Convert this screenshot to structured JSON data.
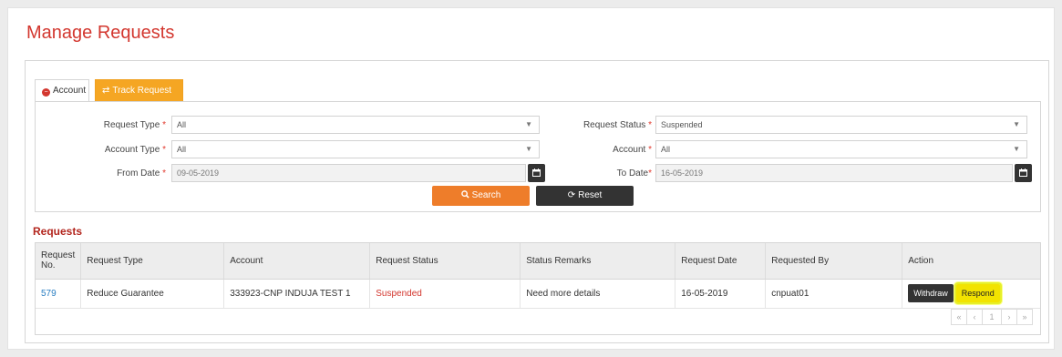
{
  "page": {
    "title": "Manage Requests"
  },
  "tabs": [
    {
      "label": "Account",
      "icon": "minus-circle-icon"
    },
    {
      "label": "Track Request",
      "icon": "exchange-icon"
    }
  ],
  "form": {
    "request_type": {
      "label": "Request Type",
      "value": "All"
    },
    "request_status": {
      "label": "Request Status",
      "value": "Suspended"
    },
    "account_type": {
      "label": "Account Type",
      "value": "All"
    },
    "account": {
      "label": "Account",
      "value": "All"
    },
    "from_date": {
      "label": "From Date",
      "value": "09-05-2019"
    },
    "to_date": {
      "label": "To Date",
      "value": "16-05-2019"
    },
    "required_mark": "*",
    "search_label": "Search",
    "reset_label": "Reset"
  },
  "requests": {
    "title": "Requests",
    "columns": [
      "Request No.",
      "Request Type",
      "Account",
      "Request Status",
      "Status Remarks",
      "Request Date",
      "Requested By",
      "Action"
    ],
    "rows": [
      {
        "request_no": "579",
        "request_type": "Reduce Guarantee",
        "account": "333923-CNP INDUJA TEST 1",
        "request_status": "Suspended",
        "status_remarks": "Need more details",
        "request_date": "16-05-2019",
        "requested_by": "cnpuat01",
        "actions": [
          "Withdraw",
          "Respond"
        ]
      }
    ],
    "pagination": {
      "first": "«",
      "prev": "‹",
      "current": "1",
      "next": "›",
      "last": "»"
    }
  },
  "colors": {
    "title": "#d3372f",
    "track_tab": "#f5a623",
    "search": "#ee7d2a",
    "dark": "#333333",
    "respond": "#f2e300"
  }
}
